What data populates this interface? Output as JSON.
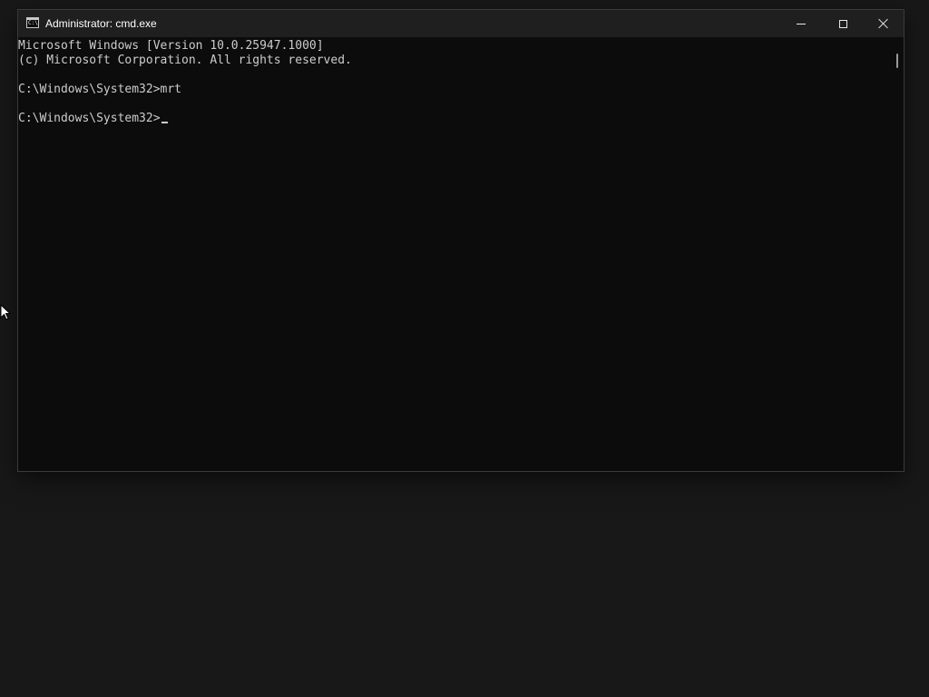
{
  "window": {
    "title": "Administrator: cmd.exe",
    "icon": "cmd-icon",
    "icon_glyph": "C:\\",
    "controls": {
      "minimize": "minimize-icon",
      "maximize": "maximize-icon",
      "close": "close-icon"
    }
  },
  "console": {
    "lines": [
      "Microsoft Windows [Version 10.0.25947.1000]",
      "(c) Microsoft Corporation. All rights reserved.",
      "",
      "C:\\Windows\\System32>mrt",
      "",
      "C:\\Windows\\System32>"
    ]
  },
  "colors": {
    "console_bg": "#0c0c0c",
    "console_text": "#cccccc",
    "titlebar_bg": "#1f1f1f",
    "desktop_bg": "#181818"
  }
}
